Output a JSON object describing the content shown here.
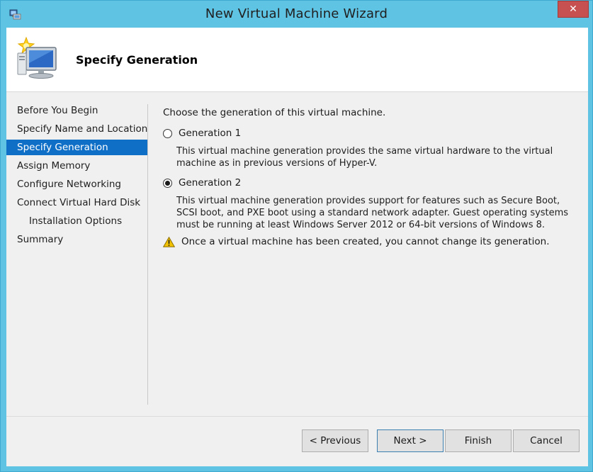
{
  "window": {
    "title": "New Virtual Machine Wizard",
    "close_glyph": "✕"
  },
  "header": {
    "title": "Specify Generation"
  },
  "nav": {
    "items": [
      {
        "label": "Before You Begin"
      },
      {
        "label": "Specify Name and Location"
      },
      {
        "label": "Specify Generation"
      },
      {
        "label": "Assign Memory"
      },
      {
        "label": "Configure Networking"
      },
      {
        "label": "Connect Virtual Hard Disk"
      },
      {
        "label": "Installation Options"
      },
      {
        "label": "Summary"
      }
    ],
    "selected": "Specify Generation"
  },
  "content": {
    "intro": "Choose the generation of this virtual machine.",
    "gen1": {
      "label": "Generation 1",
      "selected": false,
      "description": "This virtual machine generation provides the same virtual hardware to the virtual machine as in previous versions of Hyper-V."
    },
    "gen2": {
      "label": "Generation 2",
      "selected": true,
      "description": "This virtual machine generation provides support for features such as Secure Boot, SCSI boot, and PXE boot using a standard network adapter. Guest operating systems must be running at least Windows Server 2012 or 64-bit versions of Windows 8."
    },
    "warning": "Once a virtual machine has been created, you cannot change its generation."
  },
  "buttons": {
    "previous": "< Previous",
    "next": "Next >",
    "finish": "Finish",
    "cancel": "Cancel"
  },
  "colors": {
    "title_bar": "#5fc3e4",
    "selection": "#0f6fc6",
    "close_button": "#c75050"
  },
  "icons": {
    "app": "hyper-v-app-icon",
    "header": "new-virtual-machine-icon",
    "warning": "warning-icon"
  }
}
